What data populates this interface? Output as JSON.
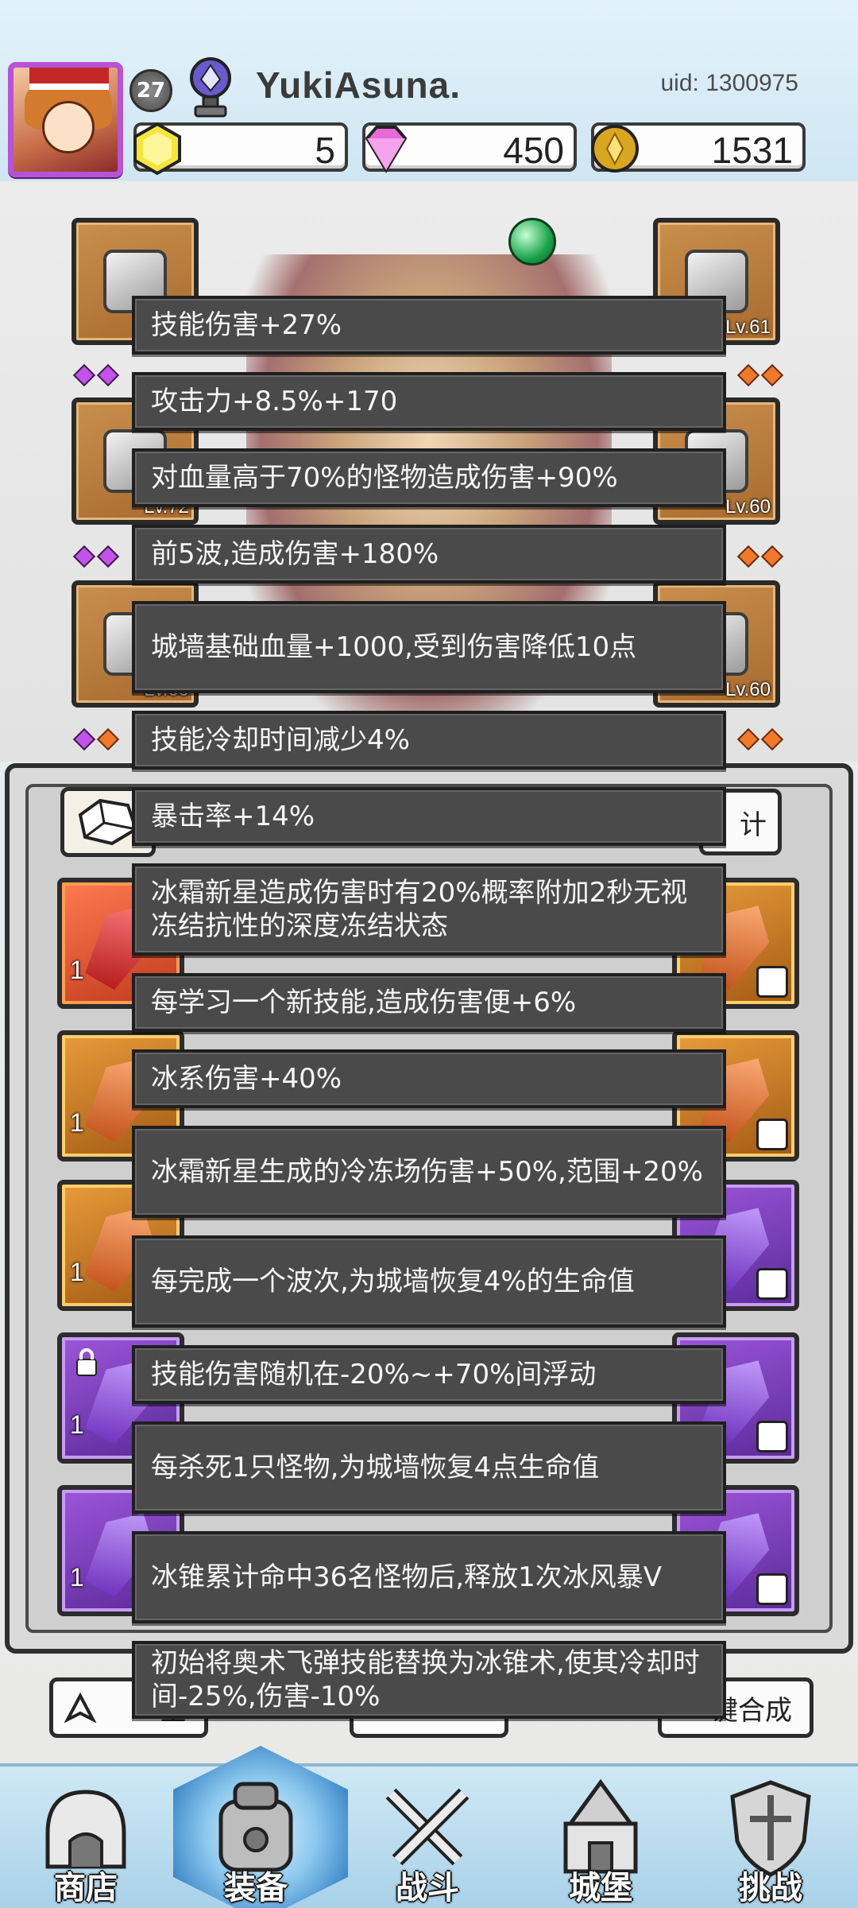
{
  "header": {
    "level": "27",
    "username": "YukiAsuna.",
    "uid": "uid: 1300975",
    "currencies": [
      {
        "name": "yellow-gem",
        "value": "5",
        "color": "#f7e53a"
      },
      {
        "name": "diamond",
        "value": "450",
        "color": "#e66bd8"
      },
      {
        "name": "gold-coin",
        "value": "1531",
        "color": "#d9a620"
      }
    ]
  },
  "equipment": {
    "slots": [
      {
        "level": ""
      },
      {
        "level": "Lv.61"
      },
      {
        "level": "Lv.72"
      },
      {
        "level": "Lv.60"
      },
      {
        "level": "Lv.60"
      },
      {
        "level": "Lv.60"
      }
    ]
  },
  "inventory": {
    "stats_button": "计",
    "cards": [
      "1",
      "1",
      "1",
      "1",
      "1",
      "1"
    ],
    "bottom_left_button": "全",
    "bottom_right_button": "键合成"
  },
  "tooltips": [
    "技能伤害+27%",
    "攻击力+8.5%+170",
    "对血量高于70%的怪物造成伤害+90%",
    "前5波,造成伤害+180%",
    "城墙基础血量+1000,受到伤害降低10点",
    "技能冷却时间减少4%",
    "暴击率+14%",
    "冰霜新星造成伤害时有20%概率附加2秒无视冻结抗性的深度冻结状态",
    "每学习一个新技能,造成伤害便+6%",
    "冰系伤害+40%",
    "冰霜新星生成的冷冻场伤害+50%,范围+20%",
    "每完成一个波次,为城墙恢复4%的生命值",
    "技能伤害随机在-20%~+70%间浮动",
    "每杀死1只怪物,为城墙恢复4点生命值",
    "冰锥累计命中36名怪物后,释放1次冰风暴V",
    "初始将奥术飞弹技能替换为冰锥术,使其冷却时间-25%,伤害-10%"
  ],
  "nav": {
    "items": [
      {
        "label": "商店",
        "icon": "shop-icon"
      },
      {
        "label": "装备",
        "icon": "equipment-bag-icon",
        "active": true
      },
      {
        "label": "战斗",
        "icon": "crossed-swords-icon"
      },
      {
        "label": "城堡",
        "icon": "castle-icon"
      },
      {
        "label": "挑战",
        "icon": "shield-challenge-icon"
      }
    ]
  }
}
